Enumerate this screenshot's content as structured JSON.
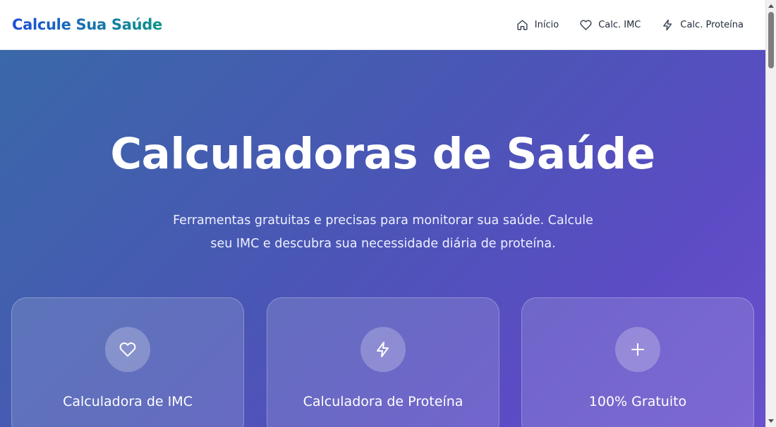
{
  "header": {
    "brand": "Calcule Sua Saúde",
    "nav": [
      {
        "label": "Início",
        "icon": "home-icon"
      },
      {
        "label": "Calc. IMC",
        "icon": "heart-icon"
      },
      {
        "label": "Calc. Proteína",
        "icon": "zap-icon"
      }
    ]
  },
  "hero": {
    "title": "Calculadoras de Saúde",
    "subtitle": "Ferramentas gratuitas e precisas para monitorar sua saúde. Calcule seu IMC e descubra sua necessidade diária de proteína."
  },
  "cards": [
    {
      "title": "Calculadora de IMC",
      "icon": "heart-icon"
    },
    {
      "title": "Calculadora de Proteína",
      "icon": "zap-icon"
    },
    {
      "title": "100% Gratuito",
      "icon": "plus-icon"
    }
  ],
  "colors": {
    "brand_gradient_start": "#1d4ed8",
    "brand_gradient_end": "#0d9488",
    "hero_gradient_start": "#3a68a8",
    "hero_gradient_end": "#6a50cc"
  }
}
